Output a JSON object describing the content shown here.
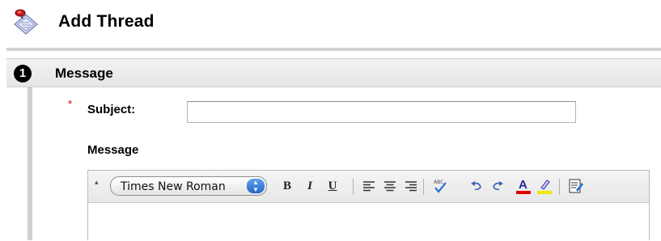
{
  "header": {
    "title": "Add Thread",
    "icon": "thread-pushpin-icon"
  },
  "step": {
    "number": "1",
    "title": "Message"
  },
  "form": {
    "subject": {
      "required_marker": "*",
      "label": "Subject:",
      "value": "",
      "placeholder": ""
    },
    "message": {
      "label": "Message"
    }
  },
  "editor": {
    "collapse_glyph": "▴",
    "font_select": {
      "selected": "Times New Roman"
    },
    "toolbar": {
      "bold": "B",
      "italic": "I",
      "underline": "U",
      "icons": [
        "align-left-icon",
        "align-center-icon",
        "align-right-icon",
        "spellcheck-icon",
        "undo-icon",
        "redo-icon",
        "text-color-icon",
        "highlight-icon",
        "preview-icon"
      ]
    },
    "colors": {
      "text_color": "#e00000",
      "highlight_color": "#f2e600"
    }
  }
}
